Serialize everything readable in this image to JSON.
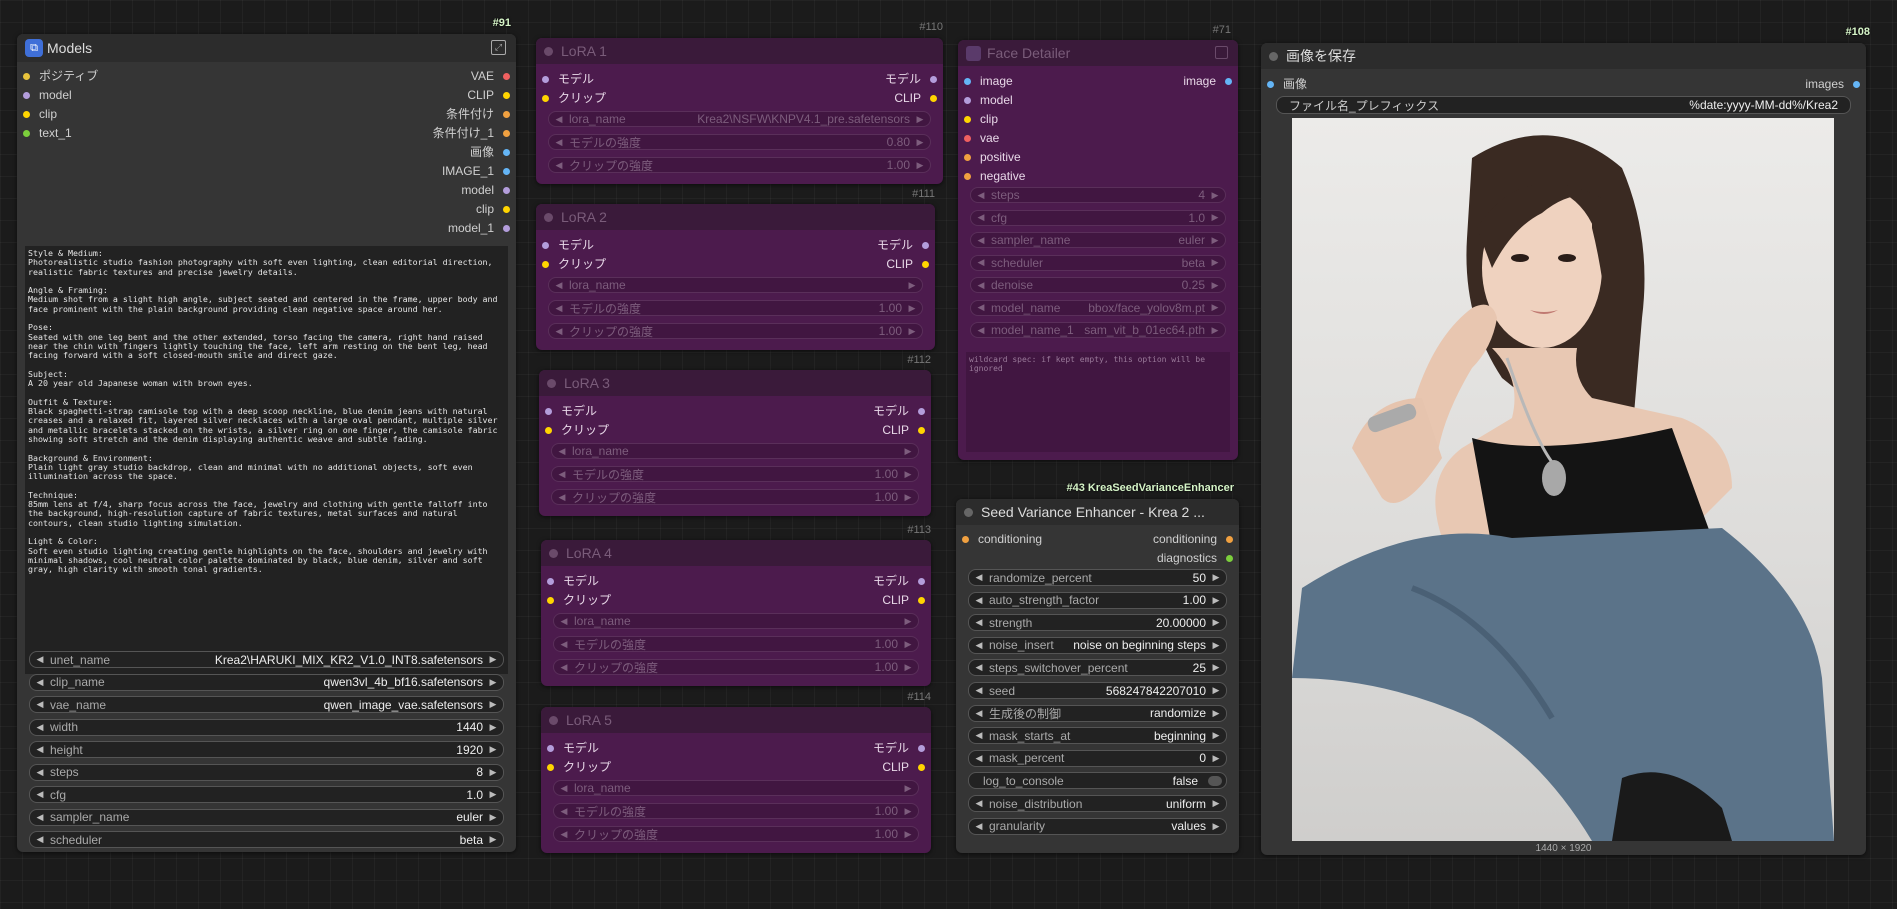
{
  "models": {
    "id": "#91",
    "title": "Models",
    "inputs": [
      "ポジティブ",
      "model",
      "clip",
      "text_1"
    ],
    "outputs": [
      "VAE",
      "CLIP",
      "条件付け",
      "条件付け_1",
      "画像",
      "IMAGE_1",
      "model",
      "clip",
      "model_1"
    ],
    "prompt": "Style & Medium:\nPhotorealistic studio fashion photography with soft even lighting, clean editorial direction, realistic fabric textures and precise jewelry details.\n\nAngle & Framing:\nMedium shot from a slight high angle, subject seated and centered in the frame, upper body and face prominent with the plain background providing clean negative space around her.\n\nPose:\nSeated with one leg bent and the other extended, torso facing the camera, right hand raised near the chin with fingers lightly touching the face, left arm resting on the bent leg, head facing forward with a soft closed-mouth smile and direct gaze.\n\nSubject:\nA 20 year old Japanese woman with brown eyes.\n\nOutfit & Texture:\nBlack spaghetti-strap camisole top with a deep scoop neckline, blue denim jeans with natural creases and a relaxed fit, layered silver necklaces with a large oval pendant, multiple silver and metallic bracelets stacked on the wrists, a silver ring on one finger, the camisole fabric showing soft stretch and the denim displaying authentic weave and subtle fading.\n\nBackground & Environment:\nPlain light gray studio backdrop, clean and minimal with no additional objects, soft even illumination across the space.\n\nTechnique:\n85mm lens at f/4, sharp focus across the face, jewelry and clothing with gentle falloff into the background, high-resolution capture of fabric textures, metal surfaces and natural contours, clean studio lighting simulation.\n\nLight & Color:\nSoft even studio lighting creating gentle highlights on the face, shoulders and jewelry with minimal shadows, cool neutral color palette dominated by black, blue denim, silver and soft gray, high clarity with smooth tonal gradients.",
    "widgets": [
      {
        "name": "unet_name",
        "value": "Krea2\\HARUKI_MIX_KR2_V1.0_INT8.safetensors"
      },
      {
        "name": "clip_name",
        "value": "qwen3vl_4b_bf16.safetensors"
      },
      {
        "name": "vae_name",
        "value": "qwen_image_vae.safetensors"
      },
      {
        "name": "width",
        "value": "1440"
      },
      {
        "name": "height",
        "value": "1920"
      },
      {
        "name": "steps",
        "value": "8"
      },
      {
        "name": "cfg",
        "value": "1.0"
      },
      {
        "name": "sampler_name",
        "value": "euler"
      },
      {
        "name": "scheduler",
        "value": "beta"
      }
    ]
  },
  "loras": [
    {
      "id": "#110",
      "title": "LoRA 1",
      "in_model": "モデル",
      "in_clip": "クリップ",
      "out_model": "モデル",
      "out_clip": "CLIP",
      "widgets": [
        {
          "name": "lora_name",
          "value": "Krea2\\NSFW\\KNPV4.1_pre.safetensors"
        },
        {
          "name": "モデルの強度",
          "value": "0.80"
        },
        {
          "name": "クリップの強度",
          "value": "1.00"
        }
      ]
    },
    {
      "id": "#111",
      "title": "LoRA 2",
      "in_model": "モデル",
      "in_clip": "クリップ",
      "out_model": "モデル",
      "out_clip": "CLIP",
      "widgets": [
        {
          "name": "lora_name",
          "value": ""
        },
        {
          "name": "モデルの強度",
          "value": "1.00"
        },
        {
          "name": "クリップの強度",
          "value": "1.00"
        }
      ]
    },
    {
      "id": "#112",
      "title": "LoRA 3",
      "in_model": "モデル",
      "in_clip": "クリップ",
      "out_model": "モデル",
      "out_clip": "CLIP",
      "widgets": [
        {
          "name": "lora_name",
          "value": ""
        },
        {
          "name": "モデルの強度",
          "value": "1.00"
        },
        {
          "name": "クリップの強度",
          "value": "1.00"
        }
      ]
    },
    {
      "id": "#113",
      "title": "LoRA 4",
      "in_model": "モデル",
      "in_clip": "クリップ",
      "out_model": "モデル",
      "out_clip": "CLIP",
      "widgets": [
        {
          "name": "lora_name",
          "value": ""
        },
        {
          "name": "モデルの強度",
          "value": "1.00"
        },
        {
          "name": "クリップの強度",
          "value": "1.00"
        }
      ]
    },
    {
      "id": "#114",
      "title": "LoRA 5",
      "in_model": "モデル",
      "in_clip": "クリップ",
      "out_model": "モデル",
      "out_clip": "CLIP",
      "widgets": [
        {
          "name": "lora_name",
          "value": ""
        },
        {
          "name": "モデルの強度",
          "value": "1.00"
        },
        {
          "name": "クリップの強度",
          "value": "1.00"
        }
      ]
    }
  ],
  "face": {
    "id": "#71",
    "title": "Face Detailer",
    "inputs": [
      "image",
      "model",
      "clip",
      "vae",
      "positive",
      "negative"
    ],
    "output": "image",
    "widgets": [
      {
        "name": "steps",
        "value": "4"
      },
      {
        "name": "cfg",
        "value": "1.0"
      },
      {
        "name": "sampler_name",
        "value": "euler"
      },
      {
        "name": "scheduler",
        "value": "beta"
      },
      {
        "name": "denoise",
        "value": "0.25"
      },
      {
        "name": "model_name",
        "value": "bbox/face_yolov8m.pt"
      },
      {
        "name": "model_name_1",
        "value": "sam_vit_b_01ec64.pth"
      }
    ],
    "wildcard": "wildcard spec: if kept empty, this option will be ignored"
  },
  "seed": {
    "id": "#43 KreaSeedVarianceEnhancer",
    "title": "Seed Variance Enhancer - Krea 2 ...",
    "input": "conditioning",
    "outputs": [
      "conditioning",
      "diagnostics"
    ],
    "widgets": [
      {
        "name": "randomize_percent",
        "value": "50"
      },
      {
        "name": "auto_strength_factor",
        "value": "1.00"
      },
      {
        "name": "strength",
        "value": "20.00000"
      },
      {
        "name": "noise_insert",
        "value": "noise on beginning steps"
      },
      {
        "name": "steps_switchover_percent",
        "value": "25"
      },
      {
        "name": "seed",
        "value": "568247842207010"
      },
      {
        "name": "生成後の制御",
        "value": "randomize"
      },
      {
        "name": "mask_starts_at",
        "value": "beginning"
      },
      {
        "name": "mask_percent",
        "value": "0"
      },
      {
        "name": "log_to_console",
        "value": "false"
      },
      {
        "name": "noise_distribution",
        "value": "uniform"
      },
      {
        "name": "granularity",
        "value": "values"
      }
    ]
  },
  "save": {
    "id": "#108",
    "title": "画像を保存",
    "input": "画像",
    "output": "images",
    "prefix_label": "ファイル名_プレフィックス",
    "prefix_value": "%date:yyyy-MM-dd%/Krea2",
    "dims": "1440 × 1920"
  }
}
